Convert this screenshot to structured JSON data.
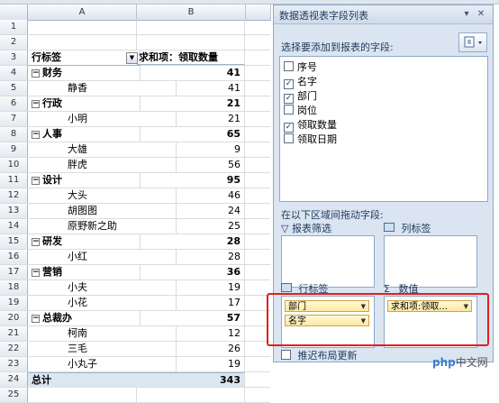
{
  "columns": {
    "a": "A",
    "b": "B"
  },
  "pivot": {
    "row_label_header": "行标签",
    "value_header": "求和项：领取数量",
    "rows": [
      {
        "rownum": "1",
        "label": "",
        "value": "",
        "kind": "empty"
      },
      {
        "rownum": "2",
        "label": "",
        "value": "",
        "kind": "empty"
      },
      {
        "rownum": "4",
        "label": "财务",
        "value": "41",
        "kind": "group"
      },
      {
        "rownum": "5",
        "label": "静香",
        "value": "41",
        "kind": "item"
      },
      {
        "rownum": "6",
        "label": "行政",
        "value": "21",
        "kind": "group"
      },
      {
        "rownum": "7",
        "label": "小明",
        "value": "21",
        "kind": "item"
      },
      {
        "rownum": "8",
        "label": "人事",
        "value": "65",
        "kind": "group"
      },
      {
        "rownum": "9",
        "label": "大雄",
        "value": "9",
        "kind": "item"
      },
      {
        "rownum": "10",
        "label": "胖虎",
        "value": "56",
        "kind": "item"
      },
      {
        "rownum": "11",
        "label": "设计",
        "value": "95",
        "kind": "group"
      },
      {
        "rownum": "12",
        "label": "大头",
        "value": "46",
        "kind": "item"
      },
      {
        "rownum": "13",
        "label": "胡图图",
        "value": "24",
        "kind": "item"
      },
      {
        "rownum": "14",
        "label": "原野新之助",
        "value": "25",
        "kind": "item"
      },
      {
        "rownum": "15",
        "label": "研发",
        "value": "28",
        "kind": "group"
      },
      {
        "rownum": "16",
        "label": "小红",
        "value": "28",
        "kind": "item"
      },
      {
        "rownum": "17",
        "label": "营销",
        "value": "36",
        "kind": "group"
      },
      {
        "rownum": "18",
        "label": "小夫",
        "value": "19",
        "kind": "item"
      },
      {
        "rownum": "19",
        "label": "小花",
        "value": "17",
        "kind": "item"
      },
      {
        "rownum": "20",
        "label": "总裁办",
        "value": "57",
        "kind": "group"
      },
      {
        "rownum": "21",
        "label": "柯南",
        "value": "12",
        "kind": "item"
      },
      {
        "rownum": "22",
        "label": "三毛",
        "value": "26",
        "kind": "item"
      },
      {
        "rownum": "23",
        "label": "小丸子",
        "value": "19",
        "kind": "item"
      },
      {
        "rownum": "24",
        "label": "总计",
        "value": "343",
        "kind": "total"
      },
      {
        "rownum": "25",
        "label": "",
        "value": "",
        "kind": "empty"
      }
    ],
    "header_rownum": "3"
  },
  "panel": {
    "title": "数据透视表字段列表",
    "choose_fields_label": "选择要添加到报表的字段:",
    "fields": [
      {
        "name": "序号",
        "checked": false
      },
      {
        "name": "名字",
        "checked": true
      },
      {
        "name": "部门",
        "checked": true
      },
      {
        "name": "岗位",
        "checked": false
      },
      {
        "name": "领取数量",
        "checked": true
      },
      {
        "name": "领取日期",
        "checked": false
      }
    ],
    "drag_label": "在以下区域间拖动字段:",
    "areas": {
      "report_filter": "报表筛选",
      "column_labels": "列标签",
      "row_labels": "行标签",
      "values": "数值"
    },
    "row_chips": [
      "部门",
      "名字"
    ],
    "value_chips": [
      "求和项:领取..."
    ],
    "defer_label": "推迟布局更新"
  },
  "watermark": {
    "prefix": "php",
    "suffix": "中文网"
  },
  "colors": {
    "accent": "#e02020",
    "panel_bg": "#dbe5f1"
  }
}
